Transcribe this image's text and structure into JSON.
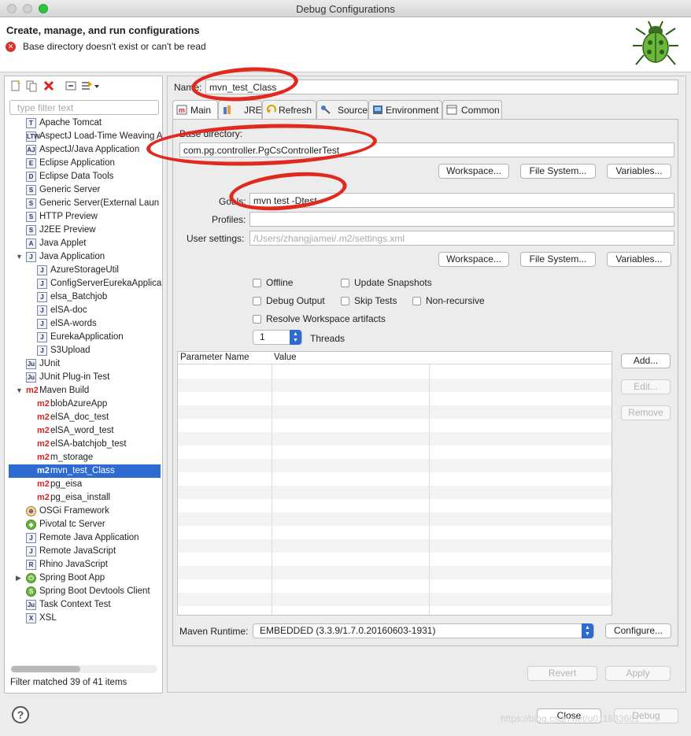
{
  "window": {
    "title": "Debug Configurations"
  },
  "header": {
    "title": "Create, manage, and run configurations",
    "error": "Base directory doesn't exist or can't be read"
  },
  "left": {
    "filter_placeholder": "type filter text",
    "tree": [
      {
        "label": "Apache Tomcat",
        "indent": 1,
        "icon": "tomcat-icon"
      },
      {
        "label": "AspectJ Load-Time Weaving A",
        "indent": 1,
        "icon": "ltw-icon"
      },
      {
        "label": "AspectJ/Java Application",
        "indent": 1,
        "icon": "aj-icon"
      },
      {
        "label": "Eclipse Application",
        "indent": 1,
        "icon": "eclipse-icon"
      },
      {
        "label": "Eclipse Data Tools",
        "indent": 1,
        "icon": "data-tools-icon"
      },
      {
        "label": "Generic Server",
        "indent": 1,
        "icon": "server-icon"
      },
      {
        "label": "Generic Server(External Laun",
        "indent": 1,
        "icon": "server-icon"
      },
      {
        "label": "HTTP Preview",
        "indent": 1,
        "icon": "server-icon"
      },
      {
        "label": "J2EE Preview",
        "indent": 1,
        "icon": "server-icon"
      },
      {
        "label": "Java Applet",
        "indent": 1,
        "icon": "applet-icon"
      },
      {
        "label": "Java Application",
        "indent": 1,
        "icon": "java-app-icon",
        "expanded": true
      },
      {
        "label": "AzureStorageUtil",
        "indent": 2,
        "icon": "java-app-icon"
      },
      {
        "label": "ConfigServerEurekaApplica",
        "indent": 2,
        "icon": "java-app-icon"
      },
      {
        "label": "elsa_Batchjob",
        "indent": 2,
        "icon": "java-app-icon"
      },
      {
        "label": "elSA-doc",
        "indent": 2,
        "icon": "java-app-icon"
      },
      {
        "label": "elSA-words",
        "indent": 2,
        "icon": "java-app-icon"
      },
      {
        "label": "EurekaApplication",
        "indent": 2,
        "icon": "java-app-icon"
      },
      {
        "label": "S3Upload",
        "indent": 2,
        "icon": "java-app-icon"
      },
      {
        "label": "JUnit",
        "indent": 1,
        "icon": "junit-icon"
      },
      {
        "label": "JUnit Plug-in Test",
        "indent": 1,
        "icon": "junit-icon"
      },
      {
        "label": "Maven Build",
        "indent": 1,
        "icon": "m2-icon",
        "expanded": true
      },
      {
        "label": "blobAzureApp",
        "indent": 2,
        "icon": "m2-icon"
      },
      {
        "label": "elSA_doc_test",
        "indent": 2,
        "icon": "m2-icon"
      },
      {
        "label": "elSA_word_test",
        "indent": 2,
        "icon": "m2-icon"
      },
      {
        "label": "elSA-batchjob_test",
        "indent": 2,
        "icon": "m2-icon"
      },
      {
        "label": "m_storage",
        "indent": 2,
        "icon": "m2-icon"
      },
      {
        "label": "mvn_test_Class",
        "indent": 2,
        "icon": "m2-icon",
        "selected": true
      },
      {
        "label": "pg_eisa",
        "indent": 2,
        "icon": "m2-icon"
      },
      {
        "label": "pg_eisa_install",
        "indent": 2,
        "icon": "m2-icon"
      },
      {
        "label": "OSGi Framework",
        "indent": 1,
        "icon": "osgi-icon"
      },
      {
        "label": "Pivotal tc Server",
        "indent": 1,
        "icon": "pivotal-icon"
      },
      {
        "label": "Remote Java Application",
        "indent": 1,
        "icon": "remote-java-icon"
      },
      {
        "label": "Remote JavaScript",
        "indent": 1,
        "icon": "remote-js-icon"
      },
      {
        "label": "Rhino JavaScript",
        "indent": 1,
        "icon": "rhino-icon"
      },
      {
        "label": "Spring Boot App",
        "indent": 1,
        "icon": "spring-boot-icon",
        "collapsed": true
      },
      {
        "label": "Spring Boot Devtools Client",
        "indent": 1,
        "icon": "spring-devtools-icon"
      },
      {
        "label": "Task Context Test",
        "indent": 1,
        "icon": "junit-icon"
      },
      {
        "label": "XSL",
        "indent": 1,
        "icon": "xsl-icon"
      }
    ],
    "filter_status": "Filter matched 39 of 41 items"
  },
  "config": {
    "name_label": "Name:",
    "name_value": "mvn_test_Class",
    "tabs": [
      "Main",
      "JRE",
      "Refresh",
      "Source",
      "Environment",
      "Common"
    ],
    "base_dir_label": "Base directory:",
    "base_dir_value": "com.pg.controller.PgCsControllerTest",
    "workspace_btn": "Workspace...",
    "filesystem_btn": "File System...",
    "variables_btn": "Variables...",
    "goals_label": "Goals:",
    "goals_value": "mvn test -Dtest",
    "profiles_label": "Profiles:",
    "profiles_value": "",
    "user_settings_label": "User settings:",
    "user_settings_placeholder": "/Users/zhangjiamei/.m2/settings.xml",
    "offline": "Offline",
    "update_snapshots": "Update Snapshots",
    "debug_output": "Debug Output",
    "skip_tests": "Skip Tests",
    "non_recursive": "Non-recursive",
    "resolve_workspace": "Resolve Workspace artifacts",
    "threads_value": "1",
    "threads_label": "Threads",
    "param_col_name": "Parameter Name",
    "param_col_value": "Value",
    "add_btn": "Add...",
    "edit_btn": "Edit...",
    "remove_btn": "Remove",
    "maven_runtime_label": "Maven Runtime:",
    "maven_runtime_value": "EMBEDDED (3.3.9/1.7.0.20160603-1931)",
    "configure_btn": "Configure...",
    "revert_btn": "Revert",
    "apply_btn": "Apply"
  },
  "footer": {
    "help": "?",
    "close_btn": "Close",
    "debug_btn": "Debug",
    "watermark": "https://blog.csdn.net/u011633661"
  },
  "colors": {
    "selection": "#2d6bd0",
    "error": "#d9342b",
    "annotation": "#e02a20",
    "maven": "#d22222"
  }
}
